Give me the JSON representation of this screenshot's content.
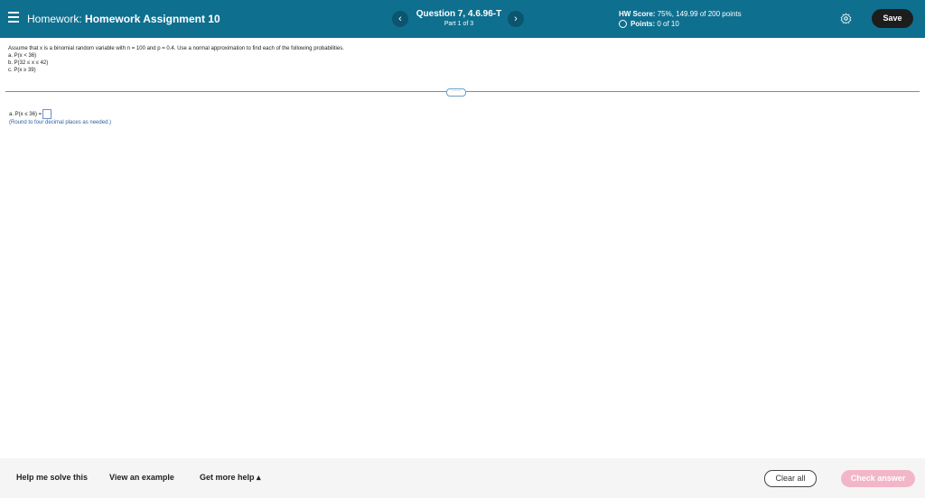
{
  "header": {
    "title_prefix": "Homework:",
    "title_name": "Homework Assignment 10",
    "question_title": "Question 7, 4.6.96-T",
    "question_part": "Part 1 of 3",
    "hw_score_label": "HW Score:",
    "hw_score_value": "75%, 149.99 of 200 points",
    "points_label": "Points:",
    "points_value": "0 of 10",
    "prev_label": "‹",
    "next_label": "›",
    "save_label": "Save"
  },
  "problem": {
    "stem": "Assume that x is a binomial random variable with n = 100 and p = 0.4. Use a normal approximation to find each of the following probabilities.",
    "items": [
      "a. P(x < 36)",
      "b. P(32 ≤ x ≤ 42)",
      "c. P(x ≥ 39)"
    ],
    "handle": "·····",
    "part_a_prompt": "a. P(x ≤ 36) =",
    "hint": "(Round to four decimal places as needed.)"
  },
  "footer": {
    "help": "Help me solve this",
    "example": "View an example",
    "more_help": "Get more help ▴",
    "clear": "Clear all",
    "check": "Check answer"
  },
  "colors": {
    "header_bg": "#0f6f8f",
    "check_button_bg": "#f3b6c8"
  }
}
